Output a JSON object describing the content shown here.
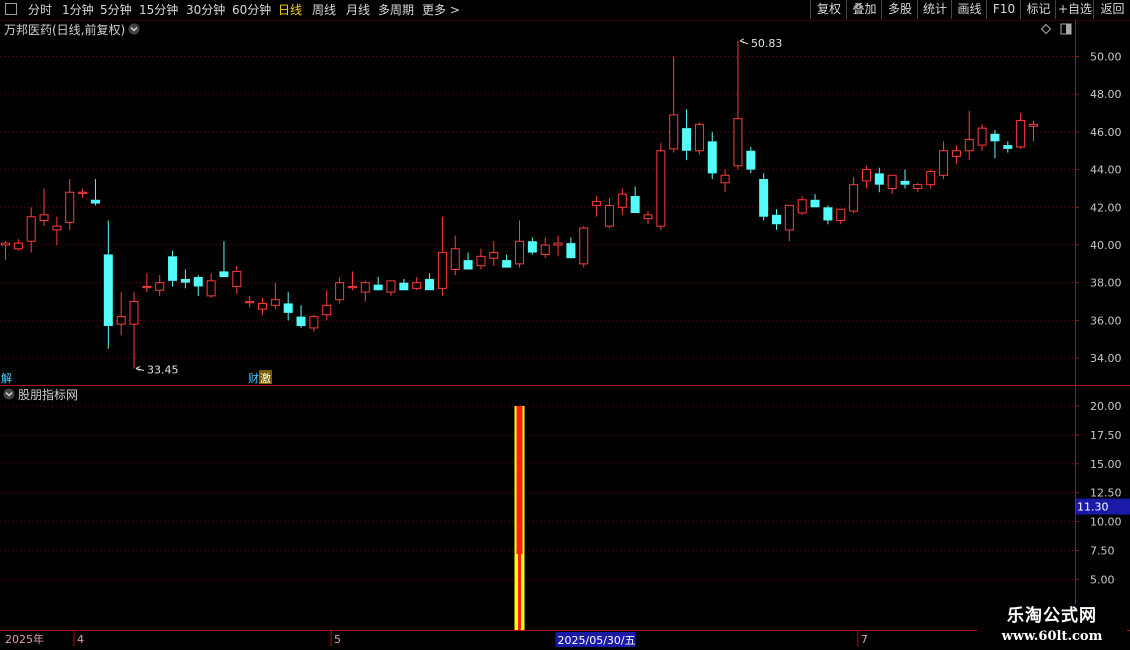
{
  "toolbar": {
    "periods": [
      "分时",
      "1分钟",
      "5分钟",
      "15分钟",
      "30分钟",
      "60分钟",
      "日线",
      "周线",
      "月线",
      "多周期",
      "更多 >"
    ],
    "active_period": "日线",
    "right_buttons": [
      "复权",
      "叠加",
      "多股",
      "统计",
      "画线",
      "F10",
      "标记",
      "+自选",
      "返回"
    ]
  },
  "main_panel": {
    "title": "万邦医药(日线,前复权)",
    "high_label": "50.83",
    "low_label": "33.45",
    "marker_left": "解",
    "marker_cai": "财",
    "marker_ji": "激"
  },
  "indicator_panel": {
    "title": "股朋指标网",
    "current_value_label": "11.30",
    "current_value": 11.3
  },
  "timeline": {
    "year_label": "2025年",
    "month_labels": [
      {
        "label": "4",
        "bar": 3
      },
      {
        "label": "5",
        "bar": 23
      },
      {
        "label": "7",
        "bar": 64
      }
    ],
    "cursor_date": "2025/05/30/五"
  },
  "watermark": {
    "title": "乐淘公式网",
    "url": "www.60lt.com"
  },
  "colors": {
    "up": "#ff3c3c",
    "down": "#54fcfc",
    "grid": "#6b0a0a",
    "axis_text": "#c8c8c8",
    "signal_red": "#ff1e1e",
    "signal_yellow": "#ffff00"
  },
  "chart_data": [
    {
      "type": "candlestick",
      "y_axis_ticks": [
        34.0,
        36.0,
        38.0,
        40.0,
        42.0,
        44.0,
        46.0,
        48.0,
        50.0
      ],
      "ylim": [
        33.0,
        51.5
      ],
      "ohlc": [
        [
          40.0,
          40.2,
          39.2,
          40.1
        ],
        [
          39.8,
          40.3,
          39.7,
          40.1
        ],
        [
          40.2,
          42.0,
          39.6,
          41.5
        ],
        [
          41.3,
          43.0,
          41.0,
          41.6
        ],
        [
          40.8,
          41.5,
          40.0,
          41.0
        ],
        [
          41.2,
          43.5,
          40.8,
          42.8
        ],
        [
          42.8,
          43.0,
          42.5,
          42.8
        ],
        [
          42.4,
          43.5,
          42.1,
          42.2
        ],
        [
          39.5,
          41.3,
          34.5,
          35.7
        ],
        [
          35.8,
          37.5,
          35.2,
          36.2
        ],
        [
          35.8,
          37.5,
          33.45,
          37.0
        ],
        [
          37.8,
          38.5,
          37.5,
          37.8
        ],
        [
          37.6,
          38.4,
          37.3,
          38.0
        ],
        [
          39.4,
          39.7,
          37.8,
          38.1
        ],
        [
          38.2,
          38.7,
          37.7,
          38.0
        ],
        [
          38.3,
          38.4,
          37.3,
          37.8
        ],
        [
          37.3,
          38.5,
          37.2,
          38.1
        ],
        [
          38.6,
          40.2,
          38.3,
          38.3
        ],
        [
          37.8,
          38.9,
          37.4,
          38.6
        ],
        [
          37.0,
          37.3,
          36.7,
          37.0
        ],
        [
          36.6,
          37.2,
          36.3,
          36.9
        ],
        [
          36.8,
          38.0,
          36.6,
          37.1
        ],
        [
          36.9,
          37.5,
          36.0,
          36.4
        ],
        [
          36.2,
          36.8,
          35.6,
          35.7
        ],
        [
          35.6,
          36.3,
          35.4,
          36.2
        ],
        [
          36.3,
          37.6,
          36.0,
          36.8
        ],
        [
          37.1,
          38.3,
          36.9,
          38.0
        ],
        [
          37.8,
          38.6,
          37.6,
          37.8
        ],
        [
          37.5,
          38.1,
          37.0,
          38.0
        ],
        [
          37.9,
          38.3,
          37.7,
          37.6
        ],
        [
          37.5,
          38.1,
          37.3,
          38.1
        ],
        [
          38.0,
          38.2,
          37.8,
          37.6
        ],
        [
          37.7,
          38.3,
          37.6,
          38.0
        ],
        [
          38.2,
          38.5,
          37.6,
          37.6
        ],
        [
          37.7,
          41.5,
          37.3,
          39.6
        ],
        [
          38.7,
          40.5,
          38.4,
          39.8
        ],
        [
          39.2,
          39.6,
          38.8,
          38.7
        ],
        [
          38.9,
          39.8,
          38.7,
          39.4
        ],
        [
          39.3,
          40.2,
          38.9,
          39.6
        ],
        [
          39.2,
          39.5,
          38.8,
          38.8
        ],
        [
          39.0,
          41.3,
          38.8,
          40.2
        ],
        [
          40.2,
          40.4,
          39.5,
          39.6
        ],
        [
          39.5,
          40.4,
          39.3,
          40.0
        ],
        [
          40.0,
          40.5,
          39.4,
          40.1
        ],
        [
          40.1,
          40.4,
          39.3,
          39.3
        ],
        [
          39.0,
          41.0,
          38.8,
          40.9
        ],
        [
          42.1,
          42.6,
          41.5,
          42.3
        ],
        [
          41.0,
          42.5,
          40.9,
          42.1
        ],
        [
          42.0,
          43.0,
          41.6,
          42.7
        ],
        [
          42.6,
          43.1,
          41.7,
          41.7
        ],
        [
          41.4,
          41.8,
          41.1,
          41.6
        ],
        [
          41.0,
          45.4,
          40.8,
          45.0
        ],
        [
          45.1,
          50.0,
          44.9,
          46.9
        ],
        [
          46.2,
          47.2,
          44.5,
          45.0
        ],
        [
          45.0,
          46.5,
          44.8,
          46.4
        ],
        [
          45.5,
          46.0,
          43.5,
          43.8
        ],
        [
          43.3,
          44.0,
          42.8,
          43.7
        ],
        [
          44.2,
          50.83,
          44.0,
          46.7
        ],
        [
          45.0,
          45.2,
          43.8,
          44.0
        ],
        [
          43.5,
          43.8,
          41.3,
          41.5
        ],
        [
          41.6,
          41.9,
          40.8,
          41.1
        ],
        [
          40.8,
          42.0,
          40.2,
          42.1
        ],
        [
          41.7,
          42.6,
          41.6,
          42.4
        ],
        [
          42.4,
          42.7,
          42.0,
          42.0
        ],
        [
          42.0,
          42.1,
          41.1,
          41.3
        ],
        [
          41.3,
          41.9,
          41.1,
          41.9
        ],
        [
          41.8,
          43.6,
          41.7,
          43.2
        ],
        [
          43.4,
          44.2,
          43.0,
          44.0
        ],
        [
          43.8,
          44.1,
          42.8,
          43.2
        ],
        [
          43.0,
          43.6,
          42.7,
          43.7
        ],
        [
          43.4,
          44.0,
          43.0,
          43.2
        ],
        [
          43.0,
          43.3,
          42.8,
          43.2
        ],
        [
          43.2,
          44.0,
          43.0,
          43.9
        ],
        [
          43.7,
          45.5,
          43.5,
          45.0
        ],
        [
          44.7,
          45.3,
          44.3,
          45.0
        ],
        [
          45.0,
          47.1,
          44.5,
          45.6
        ],
        [
          45.3,
          46.4,
          45.0,
          46.2
        ],
        [
          45.9,
          46.1,
          44.6,
          45.5
        ],
        [
          45.3,
          45.5,
          44.9,
          45.1
        ],
        [
          45.2,
          47.0,
          45.1,
          46.6
        ],
        [
          46.3,
          46.6,
          45.5,
          46.4
        ]
      ],
      "annotations": [
        {
          "text": "50.83",
          "bar": 57,
          "price": 50.83
        },
        {
          "text": "33.45",
          "bar": 10,
          "price": 33.45
        }
      ]
    },
    {
      "type": "bar",
      "y_axis_ticks": [
        5.0,
        7.5,
        10.0,
        12.5,
        15.0,
        17.5,
        20.0
      ],
      "ylim": [
        3.0,
        20.3
      ],
      "signal": {
        "bar": 40,
        "value": 20.0,
        "yellow_base": 7.2
      }
    }
  ]
}
